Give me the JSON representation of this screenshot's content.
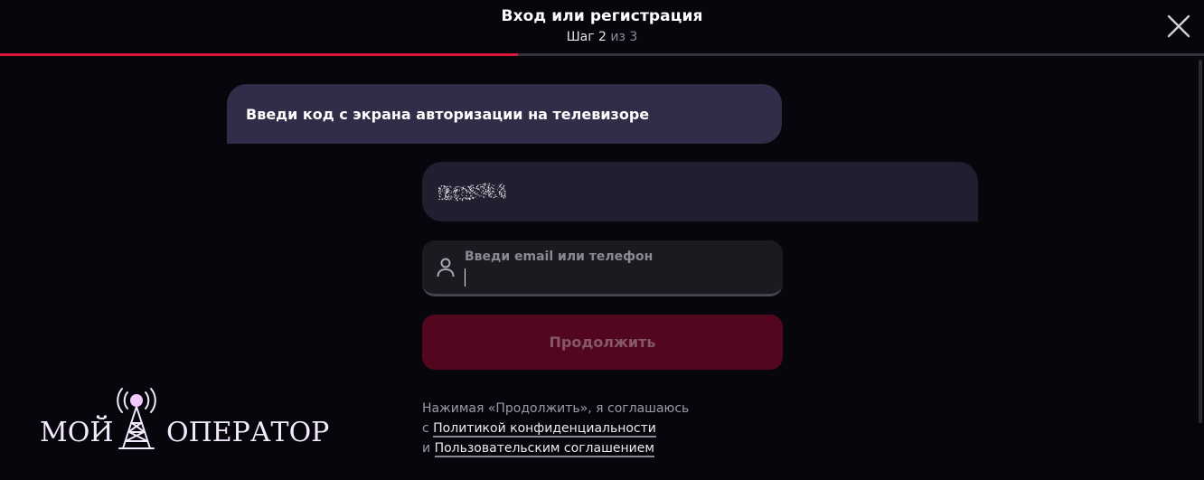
{
  "header": {
    "title": "Вход или регистрация",
    "step_word": "Шаг 2",
    "step_of": "из 3",
    "progress": 0.43,
    "close_icon": "close-icon"
  },
  "chat": {
    "question": "Введи код с экрана авторизации на телевизоре",
    "answer_masked": true
  },
  "login_field": {
    "label": "Введи email или телефон",
    "value": "",
    "icon": "user-icon"
  },
  "continue_button": {
    "label": "Продолжить",
    "disabled": true
  },
  "legal": {
    "line1": "Нажимая «Продолжить», я соглашаюсь",
    "prefix2": "с ",
    "privacy_link": "Политикой конфиденциальности",
    "prefix3": "и ",
    "terms_link": "Пользовательским соглашением"
  },
  "watermark": {
    "left": "МОЙ",
    "right": "ОПЕРАТОР"
  },
  "colors": {
    "background": "#07060d",
    "accent": "#e0163f",
    "question_bubble": "#312c47",
    "answer_bubble": "#201e2f",
    "button_disabled": "#52071f"
  }
}
